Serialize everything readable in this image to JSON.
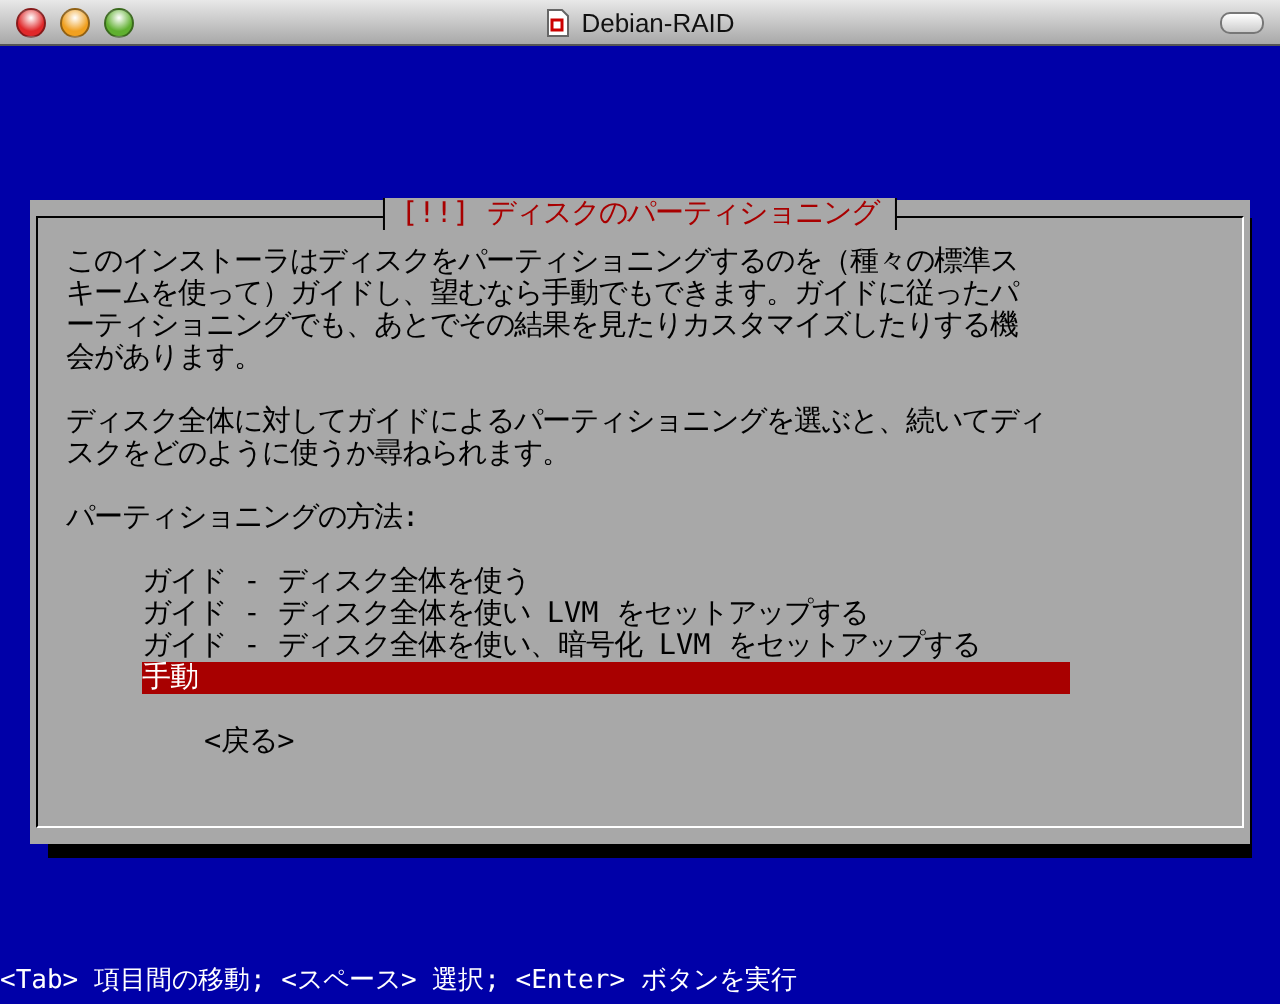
{
  "window": {
    "title": "Debian-RAID"
  },
  "dialog": {
    "title": "[!!] ディスクのパーティショニング",
    "paragraphs": [
      [
        "このインストーラはディスクをパーティショニングするのを（種々の標準ス",
        "キームを使って）ガイドし、望むなら手動でもできます。ガイドに従ったパ",
        "ーティショニングでも、あとでその結果を見たりカスタマイズしたりする機",
        "会があります。"
      ],
      [
        "ディスク全体に対してガイドによるパーティショニングを選ぶと、続いてディ",
        "スクをどのように使うか尋ねられます。"
      ]
    ],
    "prompt": "パーティショニングの方法:",
    "options": [
      {
        "label": "ガイド - ディスク全体を使う",
        "selected": false
      },
      {
        "label": "ガイド - ディスク全体を使い LVM をセットアップする",
        "selected": false
      },
      {
        "label": "ガイド - ディスク全体を使い、暗号化 LVM をセットアップする",
        "selected": false
      },
      {
        "label": "手動",
        "selected": true
      }
    ],
    "back_button": "<戻る>"
  },
  "status_bar": "<Tab> 項目間の移動; <スペース> 選択; <Enter> ボタンを実行"
}
